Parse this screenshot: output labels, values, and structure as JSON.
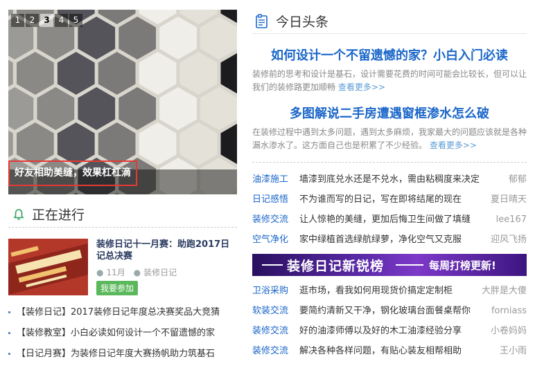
{
  "slider": {
    "pages": [
      "1",
      "2",
      "3",
      "4",
      "5"
    ],
    "active_page": "3",
    "caption": "好友相助美缝，效果杠杠滴"
  },
  "in_progress": {
    "title": "正在进行",
    "event": {
      "title": "装修日记十一月赛：助跑2017日记总决赛",
      "month": "11月",
      "category": "装修日记",
      "join_label": "我要参加"
    },
    "list": [
      "【装修日记】2017装修日记年度总决赛奖品大竞猜",
      "【装修教室】小白必读如何设计一个不留遗憾的家",
      "【日记月赛】为装修日记年度大赛扬帆助力筑基石"
    ]
  },
  "headlines": {
    "title": "今日头条",
    "stories": [
      {
        "title": "如何设计一个不留遗憾的家？小白入门必读",
        "desc": "装修前的思考和设计是基石，设计需要花费的时间可能会比较长，但可以让我们的装修路更加顺畅",
        "more": "查看更多>>"
      },
      {
        "title": "多图解说二手房遭遇窗框渗水怎么破",
        "desc": "在装修过程中遇到太多问题，遇到太多麻烦，我家最大的问题应该就是各种漏水渗水了。这方面自己也是积累了不少经验。",
        "more": "查看更多>>"
      }
    ],
    "list_top": [
      {
        "cat": "油漆施工",
        "text": "墙漆到底兑水还是不兑水，需由粘稠度来决定",
        "user": "郁郁"
      },
      {
        "cat": "日记感悟",
        "text": "不为谁而写的日记，写在即将结尾的现在",
        "user": "夏日晴天"
      },
      {
        "cat": "装修交流",
        "text": "让人惊艳的美缝，更加后悔卫生间做了填缝",
        "user": "lee167"
      },
      {
        "cat": "空气净化",
        "text": "家中绿植首选绿航绿萝，净化空气又克服",
        "user": "迎风飞扬"
      }
    ],
    "banner": {
      "main": "装修日记新锐榜",
      "sub": "每周打榜更新!"
    },
    "list_bottom": [
      {
        "cat": "卫浴采购",
        "text": "逛市场，看我如何用现货价搞定定制柜",
        "user": "大胖是大傻"
      },
      {
        "cat": "软装交流",
        "text": "要简约清新又干净，钢化玻璃台面餐桌帮你",
        "user": "forniass"
      },
      {
        "cat": "装修交流",
        "text": "好的油漆师傅以及好的木工油漆经验分享",
        "user": "小卷妈妈"
      },
      {
        "cat": "装修交流",
        "text": "解决各种各样问题，有贴心装友相帮相助",
        "user": "王小雨"
      }
    ]
  },
  "colors": {
    "accent_blue": "#1a66c9",
    "highlight_red": "#e53935",
    "join_green": "#5cb85c",
    "banner_purple": "#5b2aa8"
  }
}
